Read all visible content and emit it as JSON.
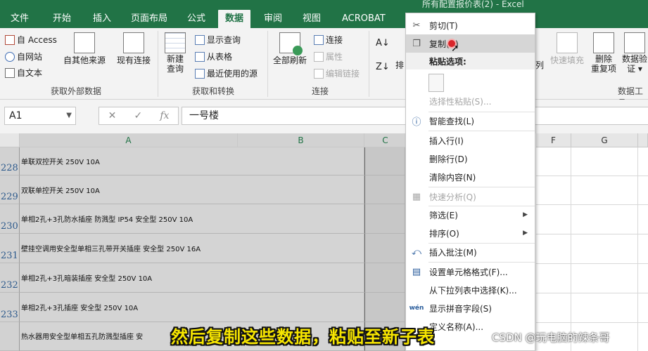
{
  "window": {
    "title": "所有配置报价表(2) - Excel"
  },
  "tabs": [
    {
      "label": "文件"
    },
    {
      "label": "开始"
    },
    {
      "label": "插入"
    },
    {
      "label": "页面布局"
    },
    {
      "label": "公式"
    },
    {
      "label": "数据"
    },
    {
      "label": "审阅"
    },
    {
      "label": "视图"
    },
    {
      "label": "ACROBAT"
    }
  ],
  "ribbon": {
    "from_access": "自 Access",
    "from_web": "自网站",
    "from_text": "自文本",
    "other_sources": "自其他来源",
    "existing_connections": "现有连接",
    "group_external": "获取外部数据",
    "new_query": "新建\n查询",
    "show_queries": "显示查询",
    "from_table": "从表格",
    "recent_sources": "最近使用的源",
    "group_transform": "获取和转换",
    "refresh_all": "全部刷新",
    "connections": "连接",
    "properties": "属性",
    "edit_links": "编辑链接",
    "group_connections": "连接",
    "sort_partial": "排",
    "columns_partial": "列",
    "flash_fill": "快速填充",
    "remove_duplicates": "删除\n重复项",
    "data_validation": "数据验\n证 ▾",
    "group_datatools": "数据工具"
  },
  "formula_bar": {
    "name_box": "A1",
    "cancel_icon": "✕",
    "enter_icon": "✓",
    "fx": "fx",
    "content": "一号楼"
  },
  "columns": [
    "A",
    "B",
    "C",
    "F",
    "G"
  ],
  "rows": [
    {
      "num": "228",
      "a": "单联双控开关 250V 10A"
    },
    {
      "num": "229",
      "a": "双联单控开关 250V 10A"
    },
    {
      "num": "230",
      "a": "单相2孔+3孔防水插座 防溅型 IP54 安全型 250V 10A"
    },
    {
      "num": "231",
      "a": "壁挂空调用安全型单相三孔带开关插座 安全型 250V 16A"
    },
    {
      "num": "232",
      "a": "单相2孔+3孔暗装插座 安全型 250V 10A"
    },
    {
      "num": "233",
      "a": "单相2孔+3孔插座 安全型 250V 10A"
    },
    {
      "num": "",
      "a": "热水器用安全型单相五孔防溅型插座 安"
    }
  ],
  "context_menu": {
    "cut": "剪切(T)",
    "copy": "复制(C)",
    "paste_options": "粘贴选项:",
    "paste_special": "选择性粘贴(S)...",
    "smart_lookup": "智能查找(L)",
    "insert_row": "插入行(I)",
    "delete_row": "删除行(D)",
    "clear_contents": "清除内容(N)",
    "quick_analysis": "快速分析(Q)",
    "filter": "筛选(E)",
    "sort": "排序(O)",
    "insert_comment": "插入批注(M)",
    "format_cells": "设置单元格格式(F)...",
    "pick_from_list": "从下拉列表中选择(K)...",
    "phonetic": "显示拼音字段(S)",
    "define_name": "定义名称(A)..."
  },
  "overlay": {
    "subtitle": "然后复制这些数据，粘贴至新子表",
    "watermark": "CSDN @玩电脑的辣条哥"
  },
  "colors": {
    "excel_green": "#217346",
    "selection_gray": "#d4d4d4",
    "subtitle_yellow": "#f6e500"
  }
}
